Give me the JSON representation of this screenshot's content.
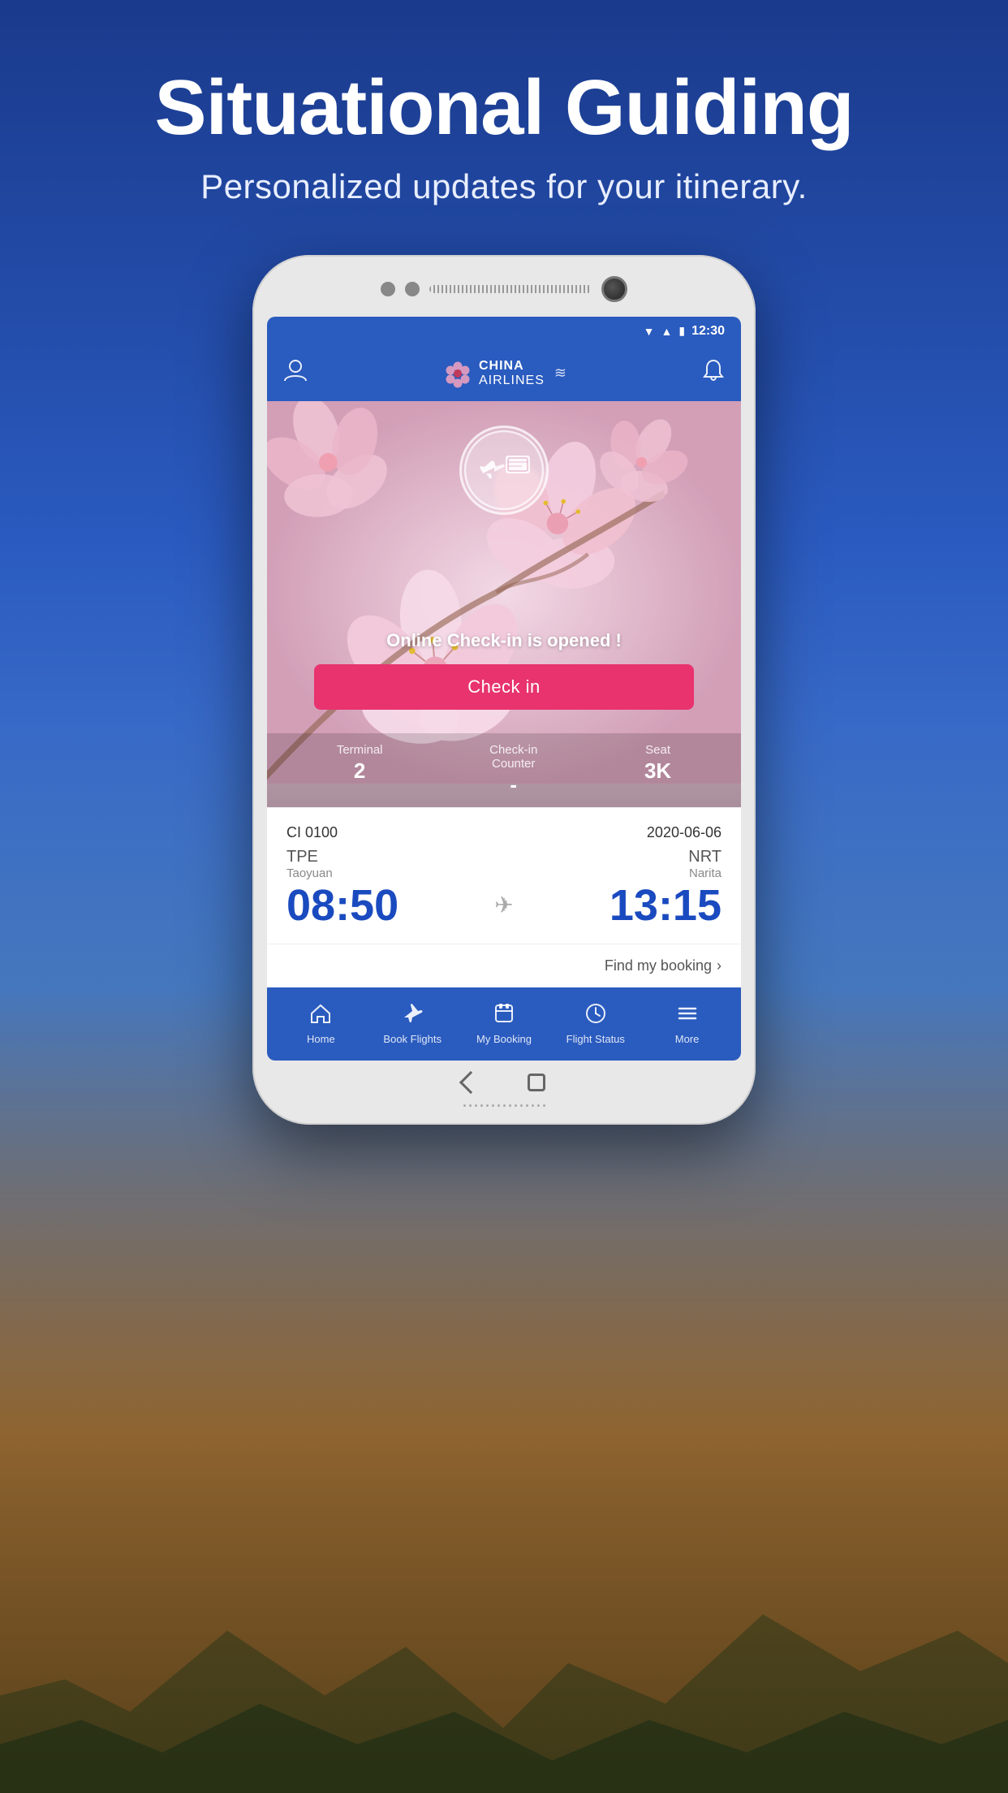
{
  "header": {
    "title": "Situational Guiding",
    "subtitle": "Personalized updates for your itinerary."
  },
  "statusBar": {
    "time": "12:30",
    "icons": [
      "wifi",
      "signal",
      "battery"
    ]
  },
  "appHeader": {
    "logoText1": "CHINA",
    "logoText2": "AIRLINES",
    "profileIconLabel": "profile-icon",
    "bellIconLabel": "bell-icon"
  },
  "hero": {
    "badgeIconPlane": "✈",
    "badgeIconTicket": "🎫",
    "notification": "Online Check-in is opened !",
    "checkinButtonLabel": "Check in"
  },
  "flightInfoStrip": {
    "items": [
      {
        "label": "Terminal",
        "value": "2"
      },
      {
        "label": "Check-in\nCounter",
        "value": "-"
      },
      {
        "label": "Seat",
        "value": "3K"
      }
    ]
  },
  "ticketCard": {
    "flightNum": "CI 0100",
    "date": "2020-06-06",
    "fromCode": "TPE",
    "fromCity": "Taoyuan",
    "toCode": "NRT",
    "toCity": "Narita",
    "departTime": "08:50",
    "arriveTime": "13:15"
  },
  "findBooking": {
    "label": "Find my booking",
    "arrow": "›"
  },
  "bottomNav": {
    "items": [
      {
        "icon": "🏠",
        "label": "Home"
      },
      {
        "icon": "✈",
        "label": "Book Flights"
      },
      {
        "icon": "📋",
        "label": "My Booking"
      },
      {
        "icon": "🕐",
        "label": "Flight Status"
      },
      {
        "icon": "☰",
        "label": "More"
      }
    ]
  },
  "colors": {
    "brand": "#2a5bbf",
    "accent": "#e8336e",
    "timeBlue": "#1a4abf"
  }
}
